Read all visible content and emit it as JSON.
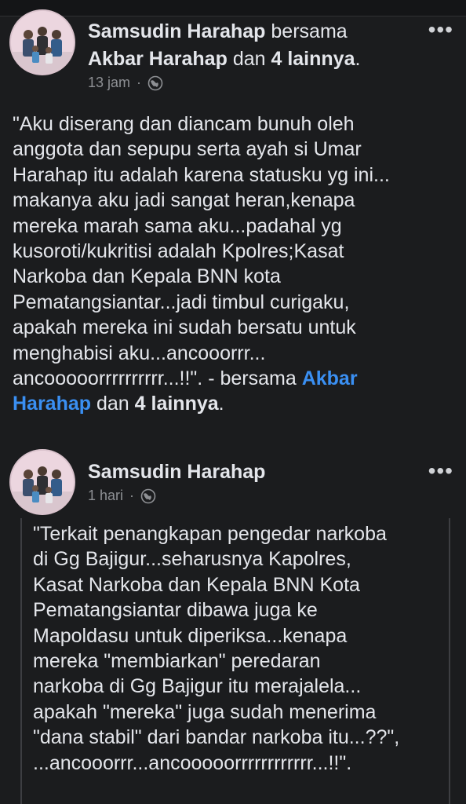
{
  "posts": [
    {
      "author": "Samsudin Harahap",
      "with_word": "bersama",
      "tagged": "Akbar Harahap",
      "and_word": "dan",
      "others": "4 lainnya",
      "period": ".",
      "time": "13 jam",
      "dot": "·",
      "privacy_icon": "globe-icon",
      "more_label": "•••",
      "text": "\"Aku diserang dan diancam bunuh oleh\nanggota dan sepupu serta ayah si Umar\nHarahap itu adalah karena statusku yg ini...\nmakanya aku jadi sangat heran,kenapa\nmereka marah sama aku...padahal yg\nkusoroti/kukritisi adalah Kpolres;Kasat\nNarkoba dan Kepala BNN kota\nPematangsiantar...jadi timbul curigaku,\napakah mereka ini sudah bersatu untuk\nmenghabisi aku...ancooorrr...\nancooooorrrrrrrrrr...!!\". - bersama ",
      "text_tag_1": "Akbar",
      "text_tag_2": "Harahap",
      "text_tail_and": " dan ",
      "text_tail_others": "4 lainnya",
      "text_tail_period": "."
    },
    {
      "author": "Samsudin Harahap",
      "time": "1 hari",
      "dot": "·",
      "privacy_icon": "globe-icon",
      "more_label": "•••",
      "text": "\"Terkait penangkapan pengedar narkoba\ndi Gg Bajigur...seharusnya Kapolres,\nKasat Narkoba dan Kepala BNN Kota\nPematangsiantar dibawa juga ke\nMapoldasu untuk diperiksa...kenapa\nmereka \"membiarkan\" peredaran\nnarkoba di Gg Bajigur itu merajalela...\napakah \"mereka\" juga sudah menerima\n\"dana stabil\" dari bandar narkoba itu...??\",\n...ancooorrr...ancooooorrrrrrrrrrrr...!!\"."
    }
  ]
}
